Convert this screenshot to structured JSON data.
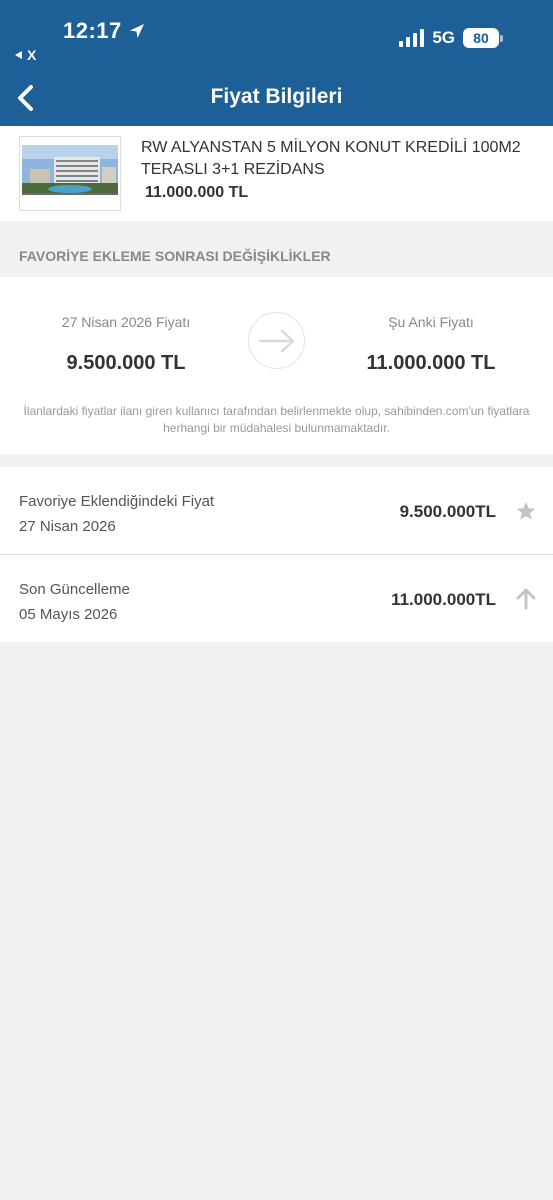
{
  "status_bar": {
    "time": "12:17",
    "back_app": "X",
    "network": "5G",
    "battery": "80"
  },
  "header": {
    "title": "Fiyat Bilgileri",
    "background": "#1d5f97"
  },
  "listing": {
    "title": "RW ALYANSTAN 5 MİLYON KONUT KREDİLİ 100M2 TERASLI 3+1 REZİDANS",
    "price": "11.000.000 TL"
  },
  "section": {
    "heading": "FAVORİYE EKLEME SONRASI DEĞİŞİKLİKLER"
  },
  "comparison": {
    "previous_label": "27 Nisan 2026 Fiyatı",
    "previous_value": "9.500.000 TL",
    "current_label": "Şu Anki Fiyatı",
    "current_value": "11.000.000 TL",
    "disclaimer": "İlanlardaki fiyatlar ilanı giren kullanıcı tarafından belirlenmekte olup, sahibinden.com'un fiyatlara herhangi bir müdahalesi bulunmamaktadır."
  },
  "rows": [
    {
      "label": "Favoriye Eklendiğindeki Fiyat",
      "date": "27 Nisan 2026",
      "price": "9.500.000TL",
      "icon": "star-icon"
    },
    {
      "label": "Son Güncelleme",
      "date": "05 Mayıs 2026",
      "price": "11.000.000TL",
      "icon": "arrow-up-icon"
    }
  ]
}
